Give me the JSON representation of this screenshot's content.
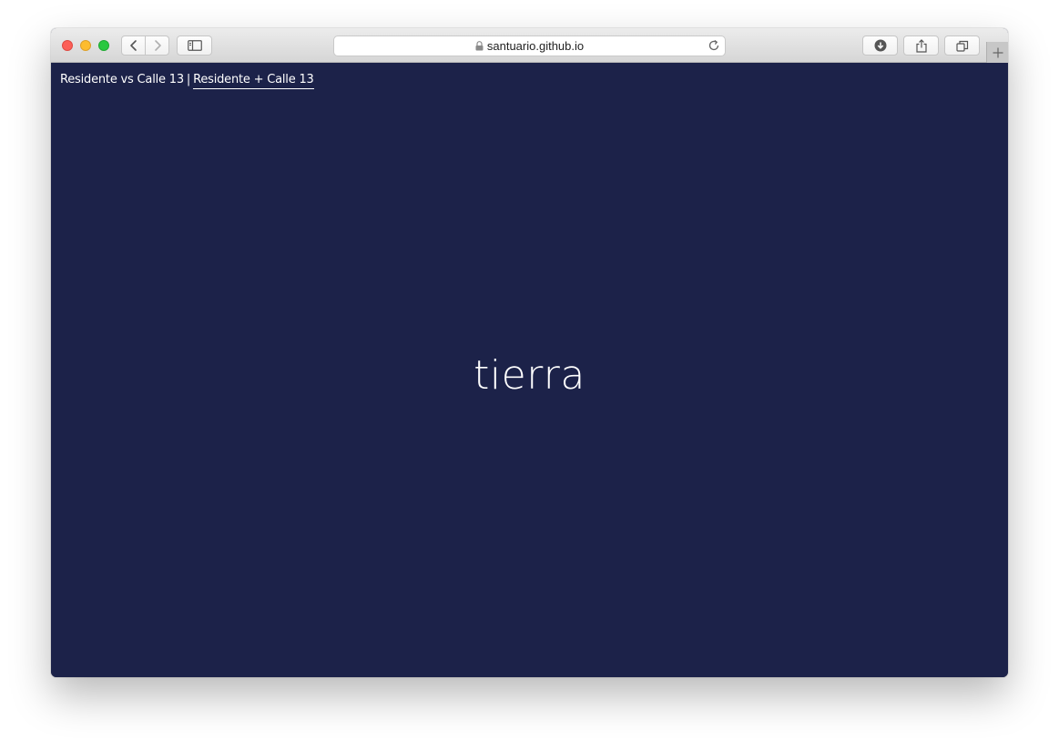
{
  "browser": {
    "url": "santuario.github.io",
    "icons": {
      "back": "chevron-left-icon",
      "forward": "chevron-right-icon",
      "sidebar": "sidebar-icon",
      "lock": "lock-icon",
      "reload": "reload-icon",
      "downloads": "download-icon",
      "share": "share-icon",
      "tabs": "tabs-icon",
      "new_tab": "plus-icon"
    }
  },
  "page": {
    "nav": {
      "link_one": "Residente vs Calle 13",
      "separator": "|",
      "link_two": "Residente + Calle 13"
    },
    "center_word": "tierra"
  },
  "colors": {
    "background": "#1c2249",
    "text": "#ffffff"
  }
}
